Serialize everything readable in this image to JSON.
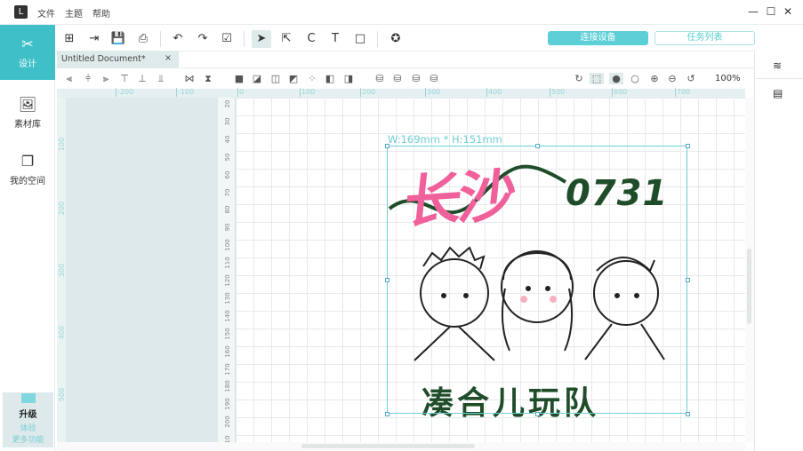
{
  "menu": {
    "items": [
      "文件",
      "主题",
      "帮助"
    ]
  },
  "window": {
    "minimize": "—",
    "maximize": "☐",
    "close": "✕"
  },
  "sidebar": {
    "items": [
      {
        "label": "设计",
        "icon": "design-icon"
      },
      {
        "label": "素材库",
        "icon": "image-library-icon"
      },
      {
        "label": "我的空间",
        "icon": "my-space-icon"
      }
    ],
    "upgrade": {
      "title": "升级",
      "line1": "体验",
      "line2": "更多功能"
    }
  },
  "toolbar": {
    "connect": "连接设备",
    "tasks": "任务列表"
  },
  "tab": {
    "title": "Untitled Document*",
    "close": "×"
  },
  "zoom": "100%",
  "ruler_top": [
    "-200",
    "-100",
    "0",
    "100",
    "200",
    "300",
    "400",
    "500",
    "600",
    "700"
  ],
  "ruler_left": [
    "100",
    "200",
    "300",
    "400",
    "500"
  ],
  "ruler_v": [
    "20",
    "30",
    "40",
    "50",
    "60",
    "70",
    "80",
    "90",
    "100",
    "110",
    "120",
    "130",
    "140",
    "150",
    "160",
    "170",
    "180",
    "190",
    "200",
    "10"
  ],
  "canvas": {
    "dims": "W:169mm * H:151mm",
    "title1": "长沙",
    "title2": "0731",
    "bottom": "凑合儿玩队"
  },
  "colors": {
    "accent": "#3fc0c9",
    "pink": "#f0609a",
    "green": "#1f4d2a"
  }
}
